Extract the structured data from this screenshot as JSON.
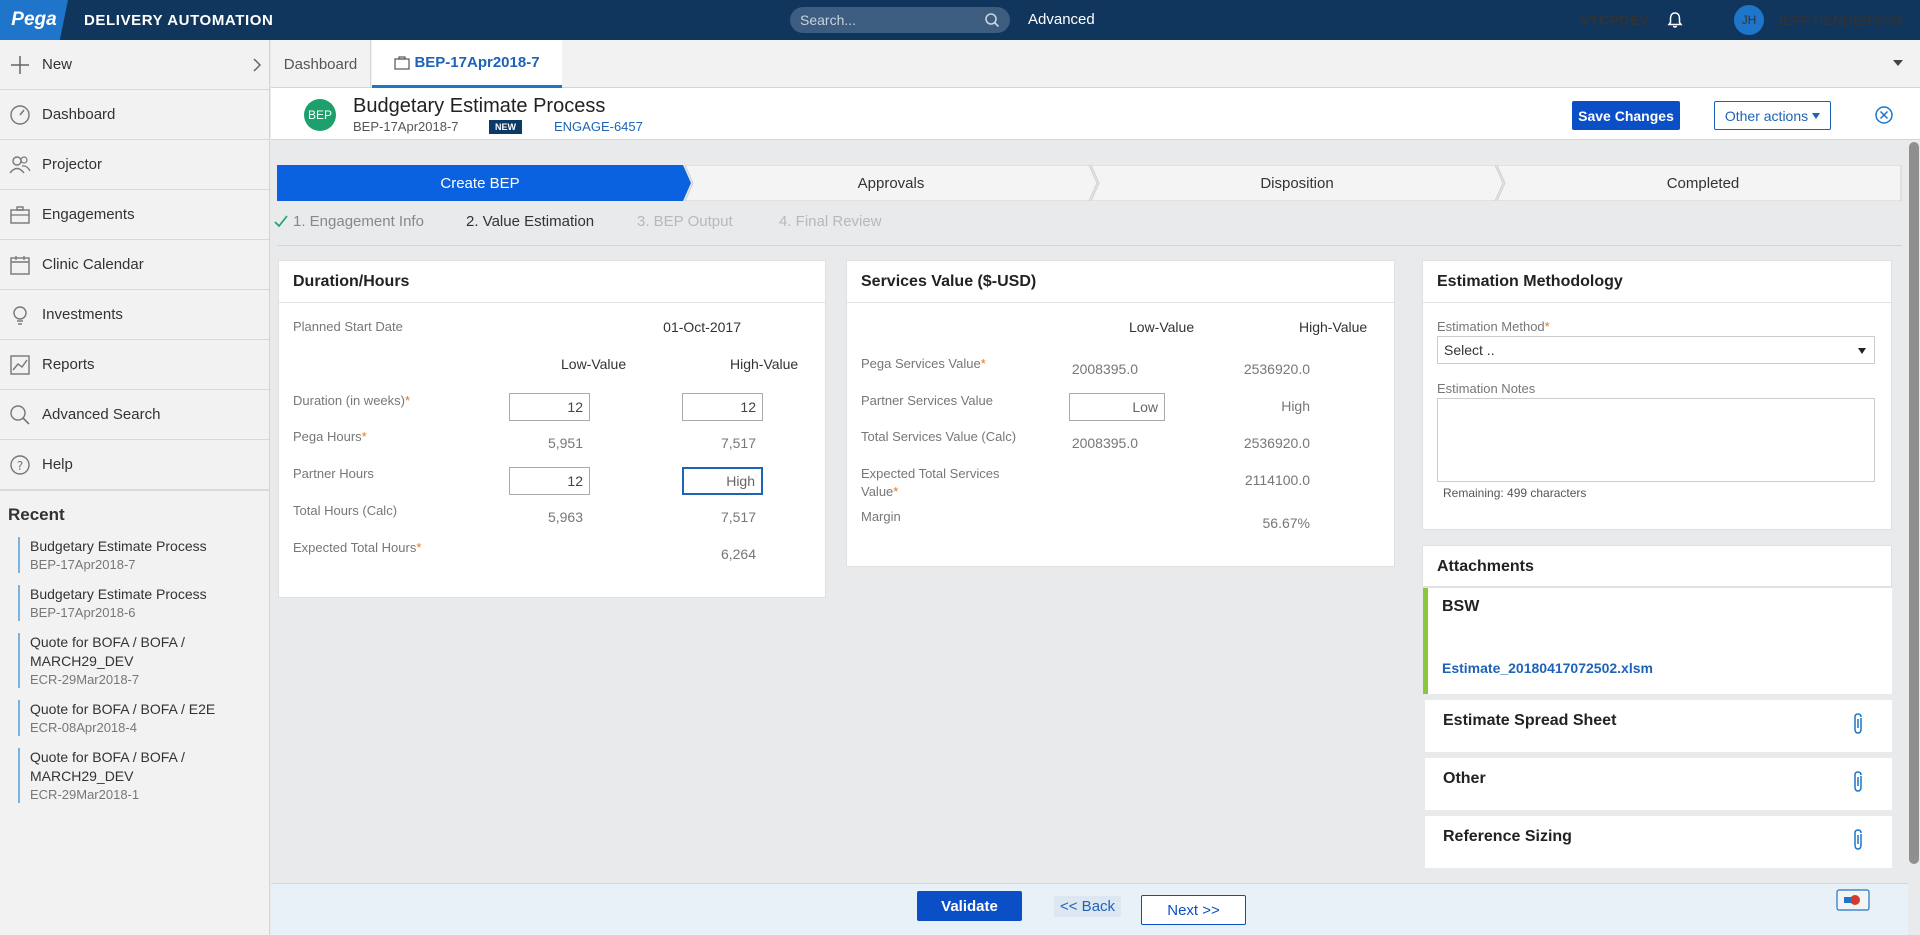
{
  "topbar": {
    "logo": "Pega",
    "app_title": "DELIVERY AUTOMATION",
    "search_placeholder": "Search...",
    "advanced_label": "Advanced",
    "environment": "VTCPDEV",
    "user_initials": "JH",
    "user_name": "JEFF HENDERSON"
  },
  "sidebar": {
    "items": [
      {
        "label": "New",
        "icon": "plus-icon"
      },
      {
        "label": "Dashboard",
        "icon": "dashboard-icon"
      },
      {
        "label": "Projector",
        "icon": "people-icon"
      },
      {
        "label": "Engagements",
        "icon": "briefcase-icon"
      },
      {
        "label": "Clinic Calendar",
        "icon": "calendar-icon"
      },
      {
        "label": "Investments",
        "icon": "lightbulb-icon"
      },
      {
        "label": "Reports",
        "icon": "chart-icon"
      },
      {
        "label": "Advanced Search",
        "icon": "search-icon"
      },
      {
        "label": "Help",
        "icon": "help-icon"
      }
    ],
    "recent_heading": "Recent",
    "recent": [
      {
        "title": "Budgetary Estimate Process",
        "sub": "BEP-17Apr2018-7"
      },
      {
        "title": "Budgetary Estimate Process",
        "sub": "BEP-17Apr2018-6"
      },
      {
        "title": "Quote for BOFA / BOFA / MARCH29_DEV",
        "sub": "ECR-29Mar2018-7"
      },
      {
        "title": "Quote for BOFA / BOFA / E2E",
        "sub": "ECR-08Apr2018-4"
      },
      {
        "title": "Quote for BOFA / BOFA / MARCH29_DEV",
        "sub": "ECR-29Mar2018-1"
      }
    ]
  },
  "tabs": {
    "dashboard": "Dashboard",
    "case": "BEP-17Apr2018-7"
  },
  "case": {
    "badge": "BEP",
    "title": "Budgetary Estimate Process",
    "id": "BEP-17Apr2018-7",
    "status": "NEW",
    "link": "ENGAGE-6457",
    "save_label": "Save Changes",
    "other_actions_label": "Other actions"
  },
  "stages": [
    "Create BEP",
    "Approvals",
    "Disposition",
    "Completed"
  ],
  "steps": [
    "1. Engagement Info",
    "2. Value Estimation",
    "3. BEP Output",
    "4. Final Review"
  ],
  "duration": {
    "title": "Duration/Hours",
    "planned_start_label": "Planned Start Date",
    "planned_start_value": "01-Oct-2017",
    "low_header": "Low-Value",
    "high_header": "High-Value",
    "duration_label": "Duration (in weeks)",
    "duration_low": "12",
    "duration_high": "12",
    "pega_hours_label": "Pega Hours",
    "pega_hours_low": "5,951",
    "pega_hours_high": "7,517",
    "partner_hours_label": "Partner Hours",
    "partner_hours_low": "12",
    "partner_hours_high": "High",
    "total_hours_label": "Total Hours (Calc)",
    "total_hours_low": "5,963",
    "total_hours_high": "7,517",
    "expected_label": "Expected Total Hours",
    "expected_value": "6,264"
  },
  "services": {
    "title": "Services Value ($-USD)",
    "low_header": "Low-Value",
    "high_header": "High-Value",
    "pega_label": "Pega Services Value",
    "pega_low": "2008395.0",
    "pega_high": "2536920.0",
    "partner_label": "Partner Services Value",
    "partner_low": "Low",
    "partner_high": "High",
    "total_label": "Total Services Value (Calc)",
    "total_low": "2008395.0",
    "total_high": "2536920.0",
    "expected_label_1": "Expected Total Services",
    "expected_label_2": "Value",
    "expected_value": "2114100.0",
    "margin_label": "Margin",
    "margin_value": "56.67%"
  },
  "estimation": {
    "title": "Estimation Methodology",
    "method_label": "Estimation Method",
    "method_value": "Select ..",
    "notes_label": "Estimation Notes",
    "remaining": "Remaining: 499 characters"
  },
  "attachments": {
    "title": "Attachments",
    "bsw_title": "BSW",
    "bsw_file": "Estimate_20180417072502.xlsm",
    "estimate_title": "Estimate Spread Sheet",
    "other_title": "Other",
    "reference_title": "Reference Sizing"
  },
  "footer": {
    "validate": "Validate",
    "back": "<< Back",
    "next": "Next >>"
  },
  "colors": {
    "topbar": "#10365d",
    "accent": "#0b4fc6",
    "stage_active": "#0b62e0",
    "required": "#e07a1f",
    "attachment_accent": "#8cc63f"
  }
}
